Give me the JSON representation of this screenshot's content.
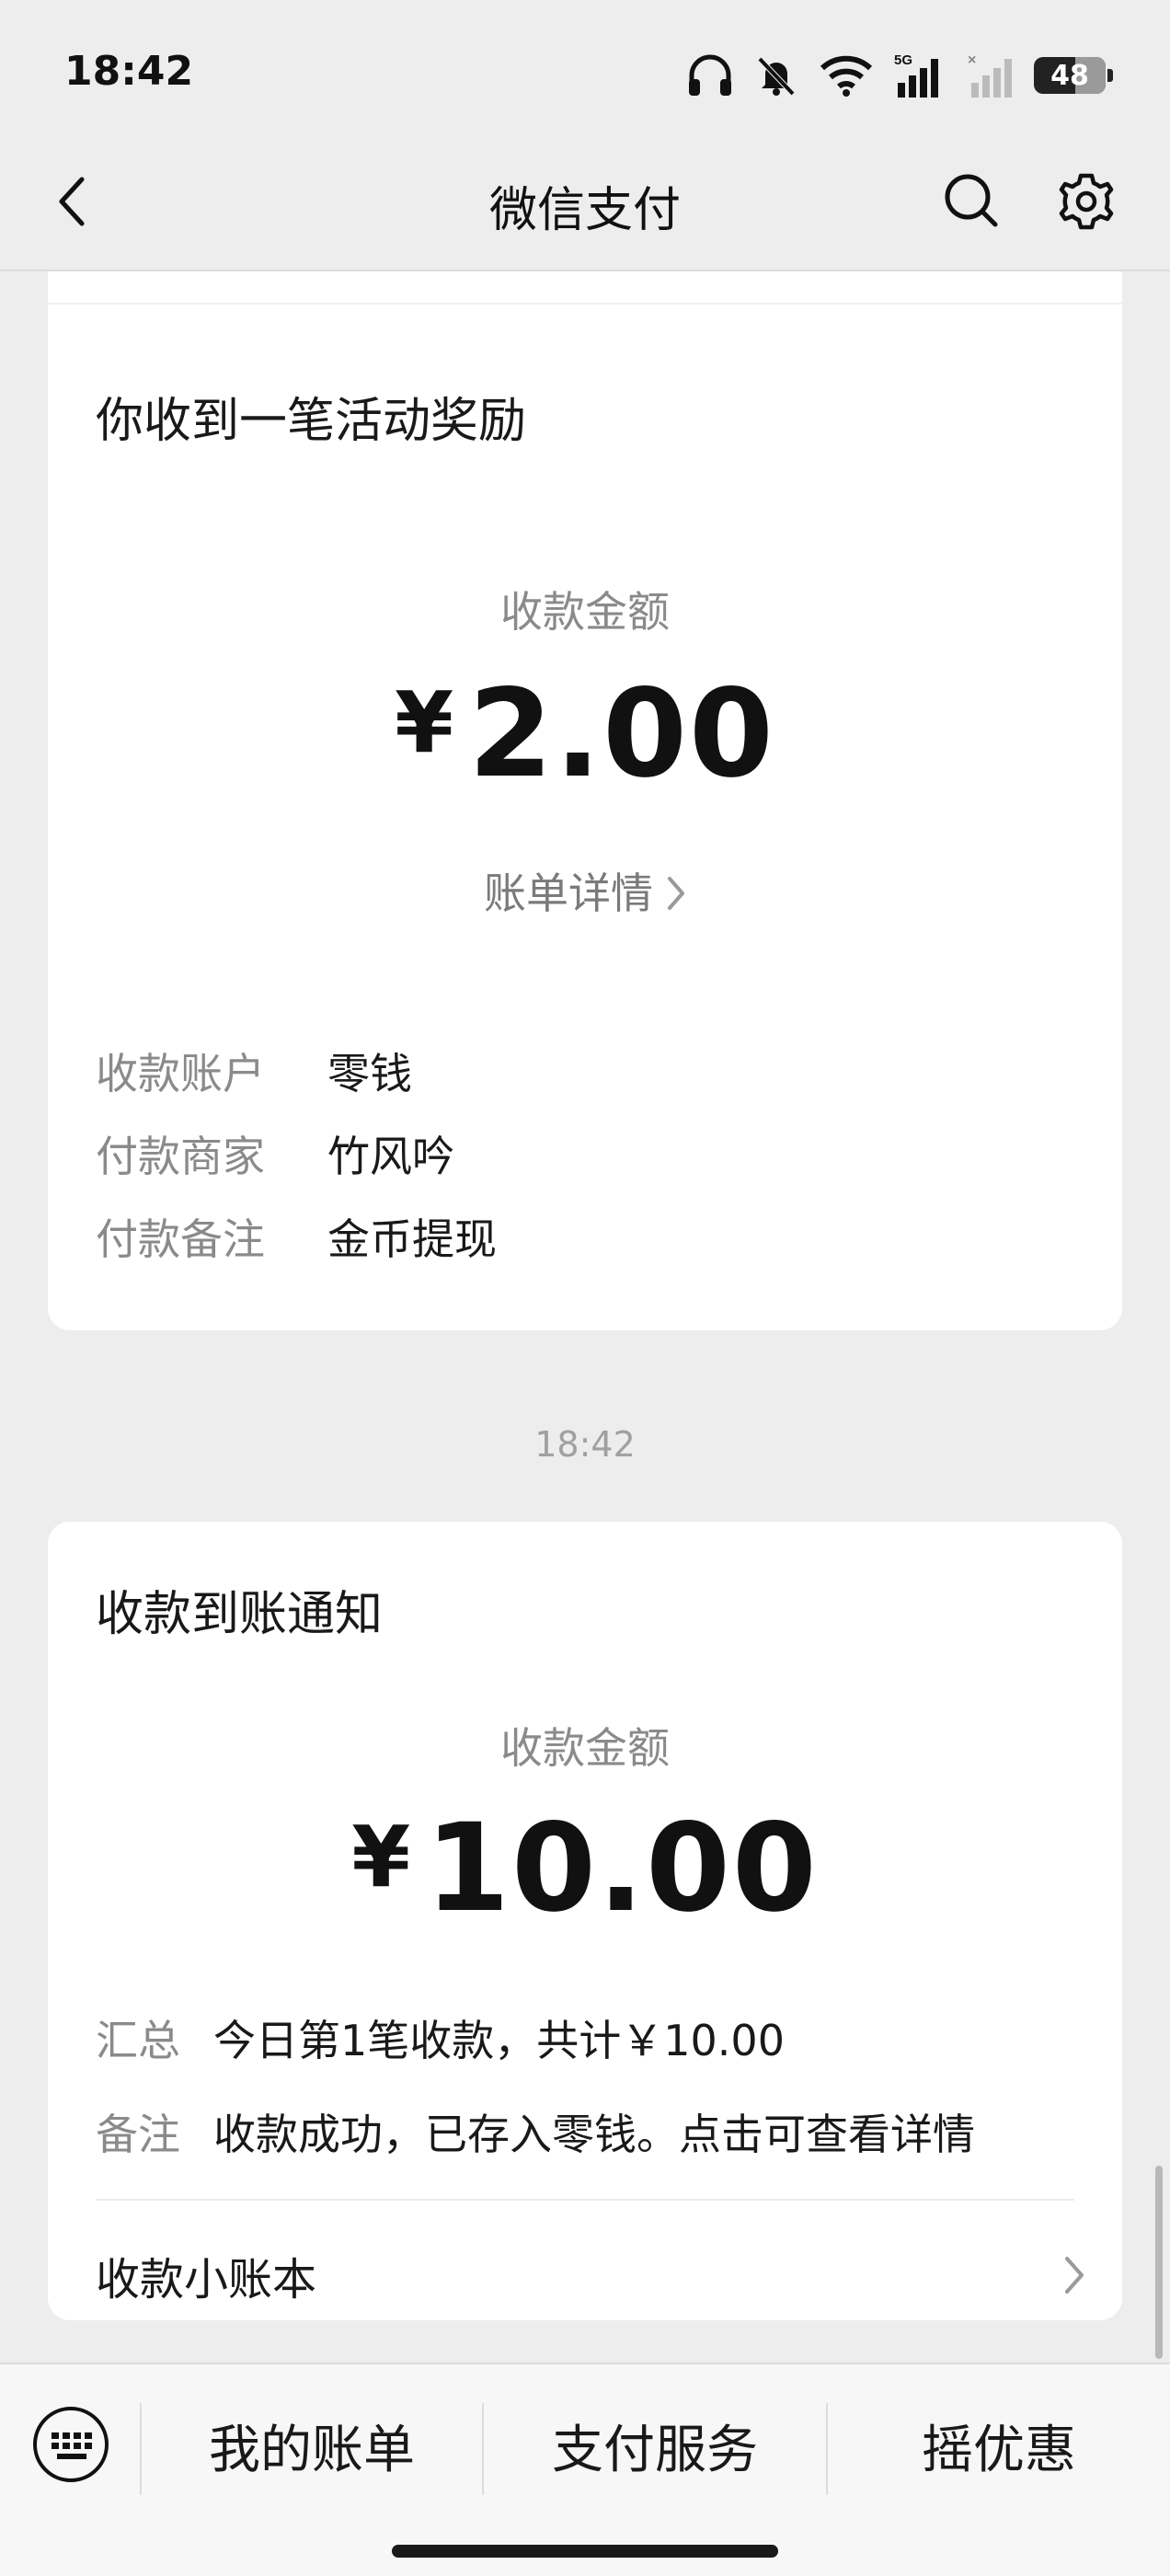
{
  "status_bar": {
    "time": "18:42",
    "battery": "48",
    "network": "5G"
  },
  "nav": {
    "title": "微信支付"
  },
  "activity_card": {
    "title": "你收到一笔活动奖励",
    "amount_label": "收款金额",
    "currency": "¥",
    "amount": "2.00",
    "detail_link": "账单详情",
    "rows": [
      {
        "key": "收款账户",
        "value": "零钱"
      },
      {
        "key": "付款商家",
        "value": "竹风吟"
      },
      {
        "key": "付款备注",
        "value": "金币提现"
      }
    ]
  },
  "timestamp": "18:42",
  "receipt_card": {
    "title": "收款到账通知",
    "amount_label": "收款金额",
    "currency": "¥",
    "amount": "10.00",
    "rows": [
      {
        "key": "汇总",
        "value": "今日第1笔收款，共计￥10.00"
      },
      {
        "key": "备注",
        "value": "收款成功，已存入零钱。点击可查看详情"
      }
    ],
    "ledger_label": "收款小账本"
  },
  "bottom_menu": {
    "items": [
      "我的账单",
      "支付服务",
      "摇优惠"
    ]
  }
}
